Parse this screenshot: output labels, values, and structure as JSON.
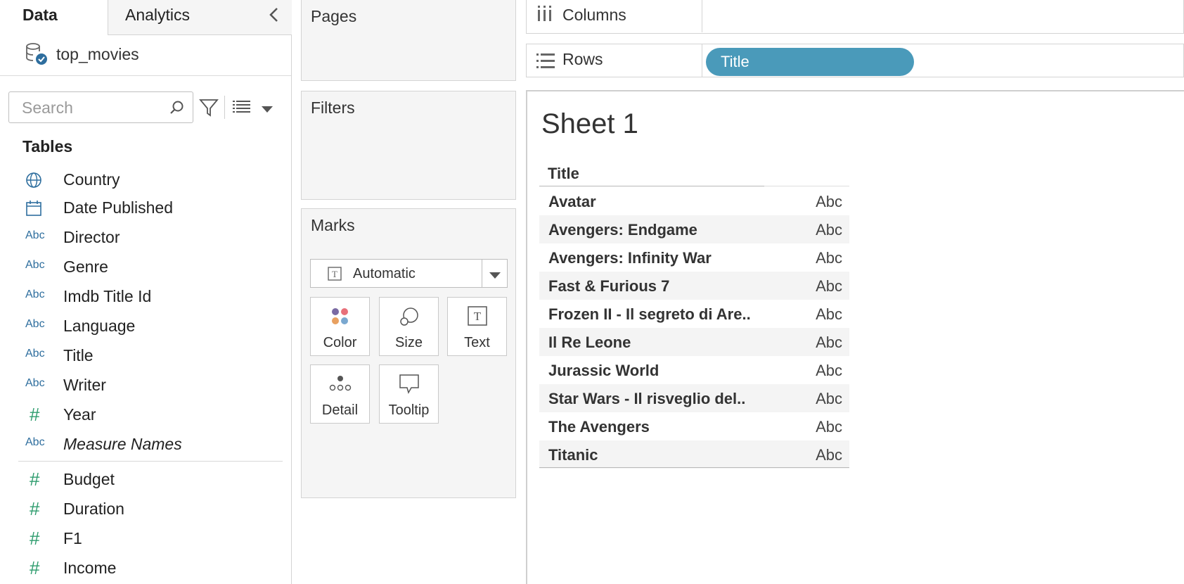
{
  "tabs": {
    "data": "Data",
    "analytics": "Analytics"
  },
  "datasource": {
    "name": "top_movies"
  },
  "search": {
    "placeholder": "Search"
  },
  "tables": {
    "header": "Tables",
    "fields": [
      {
        "icon": "globe-icon",
        "type_label": "",
        "name": "Country"
      },
      {
        "icon": "calendar-icon",
        "type_label": "",
        "name": "Date Published"
      },
      {
        "icon": "abc-icon",
        "type_label": "Abc",
        "name": "Director"
      },
      {
        "icon": "abc-icon",
        "type_label": "Abc",
        "name": "Genre"
      },
      {
        "icon": "abc-icon",
        "type_label": "Abc",
        "name": "Imdb Title Id"
      },
      {
        "icon": "abc-icon",
        "type_label": "Abc",
        "name": "Language"
      },
      {
        "icon": "abc-icon",
        "type_label": "Abc",
        "name": "Title"
      },
      {
        "icon": "abc-icon",
        "type_label": "Abc",
        "name": "Writer"
      },
      {
        "icon": "hash-icon",
        "type_label": "#",
        "name": "Year"
      },
      {
        "icon": "abc-icon",
        "type_label": "Abc",
        "name": "Measure Names"
      }
    ],
    "measures": [
      {
        "icon": "hash-icon",
        "type_label": "#",
        "name": "Budget"
      },
      {
        "icon": "hash-icon",
        "type_label": "#",
        "name": "Duration"
      },
      {
        "icon": "hash-icon",
        "type_label": "#",
        "name": "F1"
      },
      {
        "icon": "hash-icon",
        "type_label": "#",
        "name": "Income"
      }
    ]
  },
  "cards": {
    "pages": "Pages",
    "filters": "Filters",
    "marks": "Marks",
    "mark_type": "Automatic",
    "mark_buttons": {
      "color": "Color",
      "size": "Size",
      "text": "Text",
      "detail": "Detail",
      "tooltip": "Tooltip"
    }
  },
  "shelves": {
    "columns": "Columns",
    "rows": "Rows",
    "rows_pill": "Title"
  },
  "view": {
    "sheet_title": "Sheet 1",
    "column_header": "Title",
    "cell_value": "Abc",
    "rows": [
      "Avatar",
      "Avengers: Endgame",
      "Avengers: Infinity War",
      "Fast & Furious 7",
      "Frozen II - Il segreto di Are..",
      "Il Re Leone",
      "Jurassic World",
      "Star Wars - Il risveglio del..",
      "The Avengers",
      "Titanic"
    ]
  },
  "colors": {
    "pill": "#4a9aba",
    "dimension_icon": "#2e6e9e",
    "measure_icon": "#2e9c6e"
  }
}
